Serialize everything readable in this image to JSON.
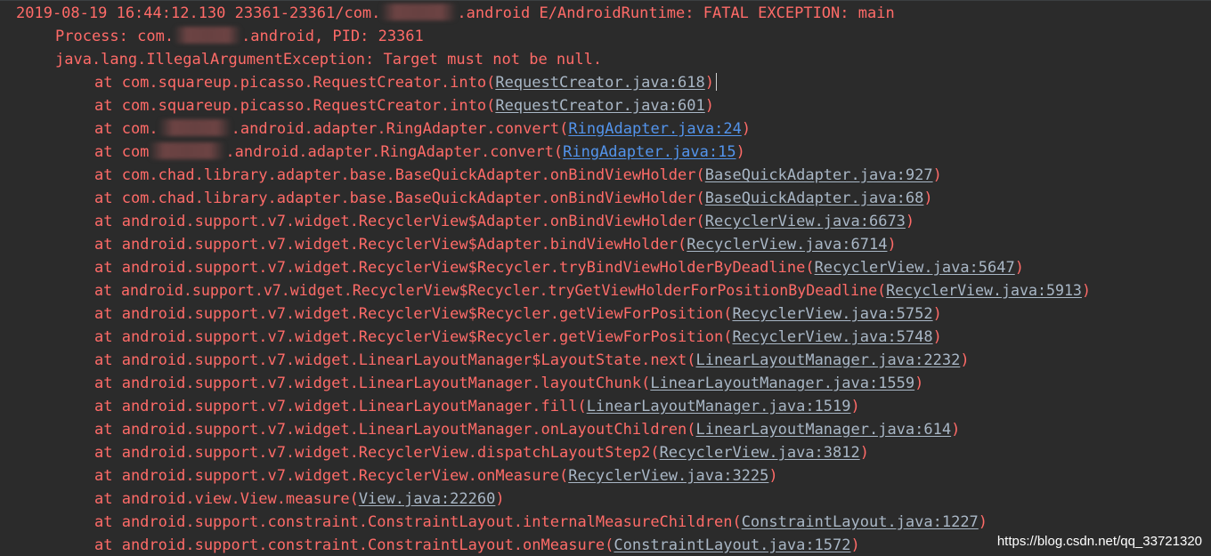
{
  "header": {
    "pre": "2019-08-19 16:44:12.130 23361-23361/com.",
    "post": ".android E/AndroidRuntime: FATAL EXCEPTION: main"
  },
  "process": {
    "pre": "Process: com.",
    "post": ".android, PID: 23361"
  },
  "exception": "java.lang.IllegalArgumentException: Target must not be null.",
  "frames": [
    {
      "pre": "at com.squareup.picasso.RequestCreator.into(",
      "link": "RequestCreator.java:618",
      "post": ")"
    },
    {
      "pre": "at com.squareup.picasso.RequestCreator.into(",
      "link": "RequestCreator.java:601",
      "post": ")"
    },
    {
      "pre": "at com.",
      "mid": ".android.adapter.RingAdapter.convert(",
      "link": "RingAdapter.java:24",
      "post": ")"
    },
    {
      "pre": "at com",
      "mid": ".android.adapter.RingAdapter.convert(",
      "link": "RingAdapter.java:15",
      "post": ")"
    },
    {
      "pre": "at com.chad.library.adapter.base.BaseQuickAdapter.onBindViewHolder(",
      "link": "BaseQuickAdapter.java:927",
      "post": ")"
    },
    {
      "pre": "at com.chad.library.adapter.base.BaseQuickAdapter.onBindViewHolder(",
      "link": "BaseQuickAdapter.java:68",
      "post": ")"
    },
    {
      "pre": "at android.support.v7.widget.RecyclerView$Adapter.onBindViewHolder(",
      "link": "RecyclerView.java:6673",
      "post": ")"
    },
    {
      "pre": "at android.support.v7.widget.RecyclerView$Adapter.bindViewHolder(",
      "link": "RecyclerView.java:6714",
      "post": ")"
    },
    {
      "pre": "at android.support.v7.widget.RecyclerView$Recycler.tryBindViewHolderByDeadline(",
      "link": "RecyclerView.java:5647",
      "post": ")"
    },
    {
      "pre": "at android.support.v7.widget.RecyclerView$Recycler.tryGetViewHolderForPositionByDeadline(",
      "link": "RecyclerView.java:5913",
      "post": ")"
    },
    {
      "pre": "at android.support.v7.widget.RecyclerView$Recycler.getViewForPosition(",
      "link": "RecyclerView.java:5752",
      "post": ")"
    },
    {
      "pre": "at android.support.v7.widget.RecyclerView$Recycler.getViewForPosition(",
      "link": "RecyclerView.java:5748",
      "post": ")"
    },
    {
      "pre": "at android.support.v7.widget.LinearLayoutManager$LayoutState.next(",
      "link": "LinearLayoutManager.java:2232",
      "post": ")"
    },
    {
      "pre": "at android.support.v7.widget.LinearLayoutManager.layoutChunk(",
      "link": "LinearLayoutManager.java:1559",
      "post": ")"
    },
    {
      "pre": "at android.support.v7.widget.LinearLayoutManager.fill(",
      "link": "LinearLayoutManager.java:1519",
      "post": ")"
    },
    {
      "pre": "at android.support.v7.widget.LinearLayoutManager.onLayoutChildren(",
      "link": "LinearLayoutManager.java:614",
      "post": ")"
    },
    {
      "pre": "at android.support.v7.widget.RecyclerView.dispatchLayoutStep2(",
      "link": "RecyclerView.java:3812",
      "post": ")"
    },
    {
      "pre": "at android.support.v7.widget.RecyclerView.onMeasure(",
      "link": "RecyclerView.java:3225",
      "post": ")"
    },
    {
      "pre": "at android.view.View.measure(",
      "link": "View.java:22260",
      "post": ")"
    },
    {
      "pre": "at android.support.constraint.ConstraintLayout.internalMeasureChildren(",
      "link": "ConstraintLayout.java:1227",
      "post": ")"
    },
    {
      "pre": "at android.support.constraint.ConstraintLayout.onMeasure(",
      "link": "ConstraintLayout.java:1572",
      "post": ")"
    }
  ],
  "watermark": "https://blog.csdn.net/qq_33721320",
  "colors": {
    "background": "#2b2b2b",
    "error_text": "#ff6b68",
    "link_grey": "#a9b7c6",
    "link_blue": "#5394ec"
  }
}
